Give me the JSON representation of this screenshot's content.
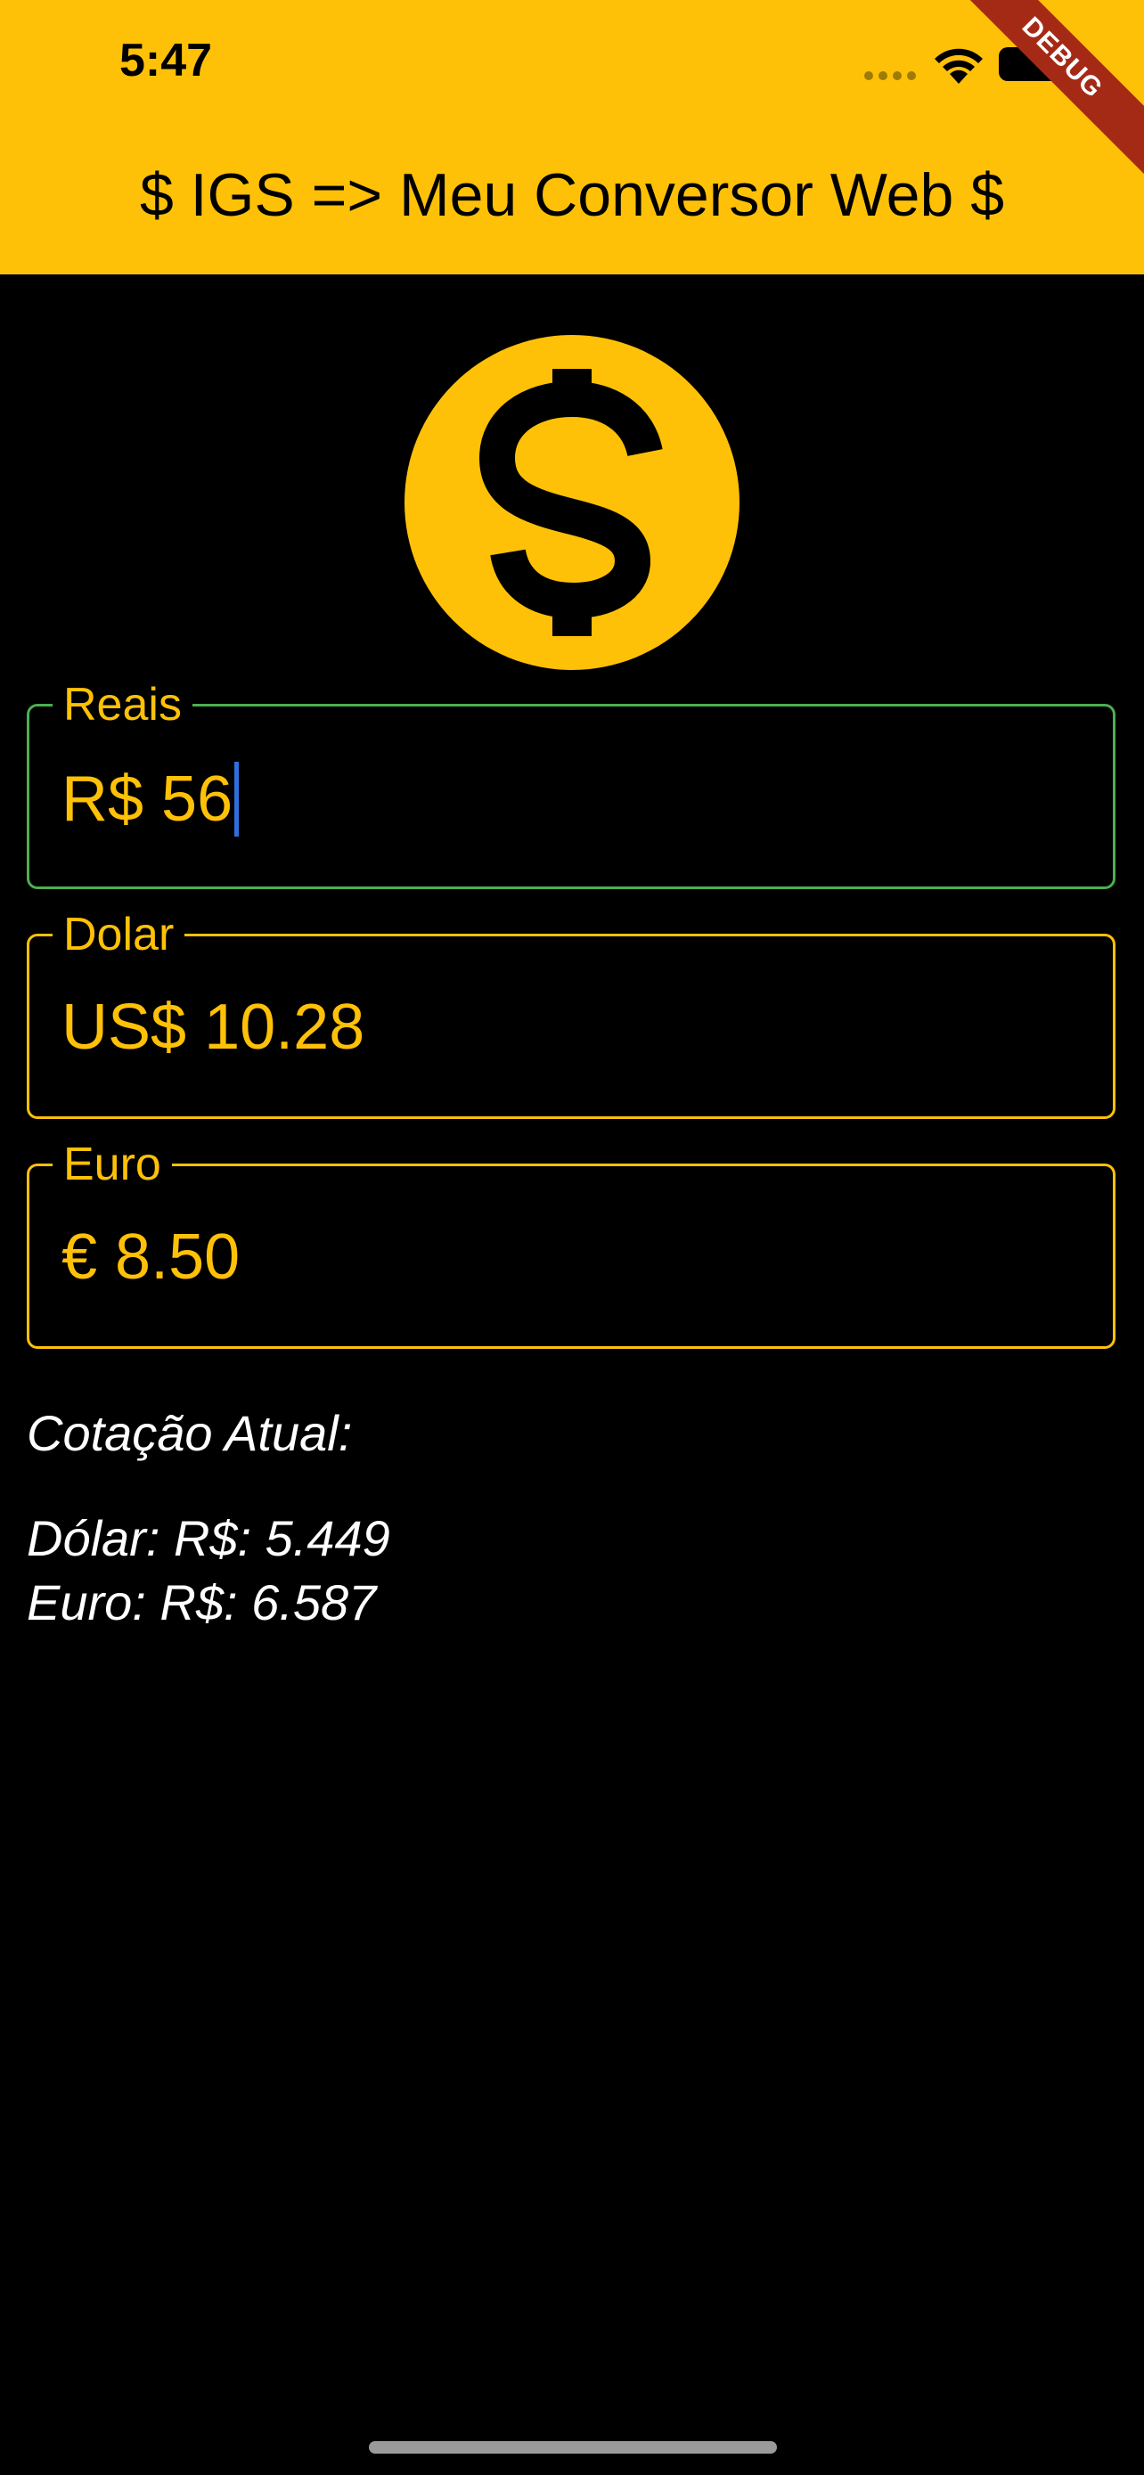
{
  "status_bar": {
    "time": "5:47",
    "icons": [
      "signal-dots-icon",
      "wifi-icon",
      "battery-icon"
    ]
  },
  "debug_banner": "DEBUG",
  "app_bar": {
    "title": "$ IGS => Meu Conversor Web $"
  },
  "logo": {
    "icon": "dollar-circle-icon"
  },
  "fields": {
    "reais": {
      "label": "Reais",
      "value": "R$ 56",
      "focused": true
    },
    "dolar": {
      "label": "Dolar",
      "value": "US$ 10.28",
      "focused": false
    },
    "euro": {
      "label": "Euro",
      "value": "€ 8.50",
      "focused": false
    }
  },
  "quote": {
    "heading": "Cotação Atual:",
    "dollar_line": "Dólar: R$: 5.449",
    "euro_line": "Euro: R$: 6.587"
  },
  "colors": {
    "accent": "#FFC107",
    "background": "#000000",
    "focus_border": "#4CAF50",
    "caret": "#2F6FDE",
    "debug_ribbon": "#A52A16"
  }
}
